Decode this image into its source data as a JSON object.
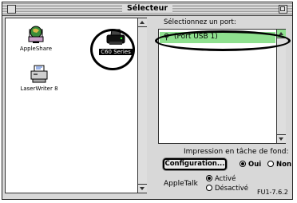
{
  "window": {
    "title": "Sélecteur"
  },
  "drivers": [
    {
      "label": "AppleShare",
      "icon": "appleshare-icon"
    },
    {
      "label": "C60 Series",
      "icon": "printer-icon",
      "selected": true
    },
    {
      "label": "LaserWriter 8",
      "icon": "laserwriter-icon"
    }
  ],
  "ports": {
    "label": "Sélectionnez un port:",
    "items": [
      {
        "label": "(Port USB 1)",
        "icon": "usb-icon",
        "selected": true
      }
    ]
  },
  "background_printing": {
    "label": "Impression en tâche de fond:",
    "configure_button": "Configuration...",
    "options": [
      {
        "label": "Oui",
        "selected": true
      },
      {
        "label": "Non",
        "selected": false
      }
    ]
  },
  "appletalk": {
    "label": "AppleTalk",
    "options": [
      {
        "label": "Activé",
        "selected": true
      },
      {
        "label": "Désactivé",
        "selected": false
      }
    ]
  },
  "version": "FU1-7.6.2",
  "colors": {
    "selection": "#8fe08f",
    "window_bg": "#d8d8d8"
  }
}
